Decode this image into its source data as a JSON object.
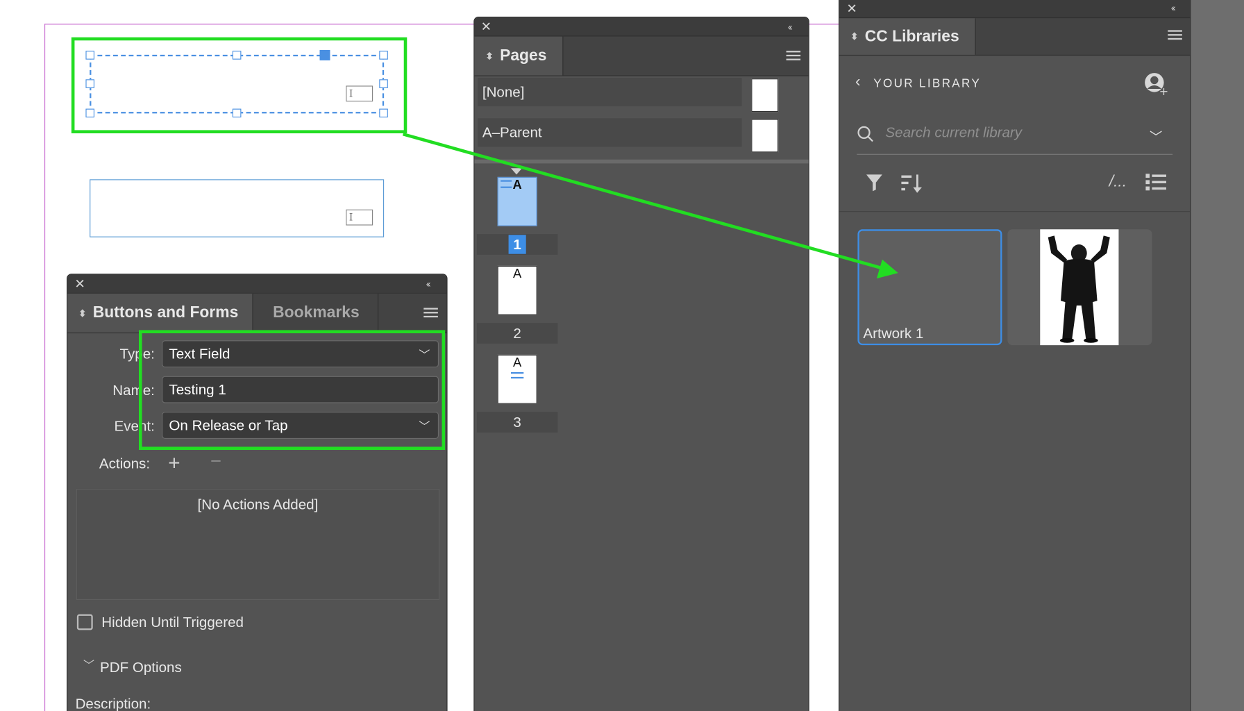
{
  "buttons_forms": {
    "tab_active": "Buttons and Forms",
    "tab_inactive": "Bookmarks",
    "type_label": "Type:",
    "type_value": "Text Field",
    "name_label": "Name:",
    "name_value": "Testing 1",
    "event_label": "Event:",
    "event_value": "On Release or Tap",
    "actions_label": "Actions:",
    "no_actions": "[No Actions Added]",
    "hidden_label": "Hidden Until Triggered",
    "hidden_checked": false,
    "pdf_options": "PDF Options",
    "description_label": "Description:"
  },
  "pages": {
    "tab": "Pages",
    "parents": [
      "[None]",
      "A–Parent"
    ],
    "page_numbers": [
      "1",
      "2",
      "3"
    ],
    "thumb_letter": "A",
    "selected_page": "1"
  },
  "cc": {
    "tab": "CC Libraries",
    "library_title": "YOUR LIBRARY",
    "search_placeholder": "Search current library",
    "view_text": "/...",
    "items": [
      "Artwork 1"
    ]
  },
  "icons": [
    "close-icon",
    "collapse-icon",
    "panel-menu-icon",
    "chevron-down-icon",
    "plus-icon",
    "minus-icon",
    "back-chevron-icon",
    "user-add-icon",
    "search-icon",
    "filter-icon",
    "sort-icon",
    "list-view-icon",
    "text-field-icon"
  ],
  "colors": {
    "accent": "#22dd22",
    "selection": "#4a90e2",
    "panel": "#535353"
  }
}
